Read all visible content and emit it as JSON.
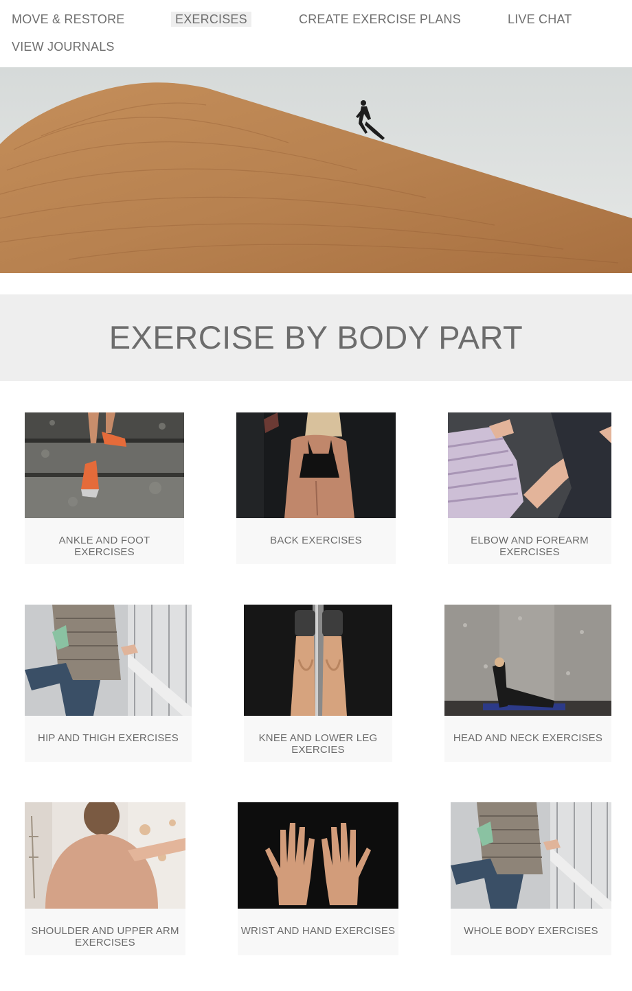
{
  "nav": {
    "items": [
      {
        "label": "MOVE & RESTORE"
      },
      {
        "label": "EXERCISES",
        "active": true
      },
      {
        "label": "CREATE EXERCISE PLANS"
      },
      {
        "label": "LIVE CHAT"
      },
      {
        "label": "VIEW JOURNALS"
      }
    ]
  },
  "hero": {
    "image": "runner-on-sandstone-ridge"
  },
  "section": {
    "title": "EXERCISE BY BODY PART"
  },
  "cards": [
    {
      "label": "ANKLE AND FOOT EXERCISES",
      "image": "feet-climbing-stairs"
    },
    {
      "label": "BACK EXERCISES",
      "image": "woman-back-sports-bra"
    },
    {
      "label": "ELBOW AND FOREARM EXERCISES",
      "image": "elbow-bump"
    },
    {
      "label": "HIP AND THIGH EXERCISES",
      "image": "quad-stretch-on-bridge"
    },
    {
      "label": "KNEE AND LOWER LEG EXERCIES",
      "image": "legs-on-rowing-machine"
    },
    {
      "label": "HEAD AND NECK EXERCISES",
      "image": "yoga-cobra-pose"
    },
    {
      "label": "SHOULDER AND UPPER ARM EXERCISES",
      "image": "shoulder-massage"
    },
    {
      "label": "WRIST AND HAND EXERCISES",
      "image": "open-palms"
    },
    {
      "label": "WHOLE BODY EXERCISES",
      "image": "quad-stretch-on-bridge"
    }
  ],
  "colors": {
    "accent_bg": "#eeeeee",
    "text": "#6b6b6b",
    "card_bg": "#f8f8f8"
  }
}
